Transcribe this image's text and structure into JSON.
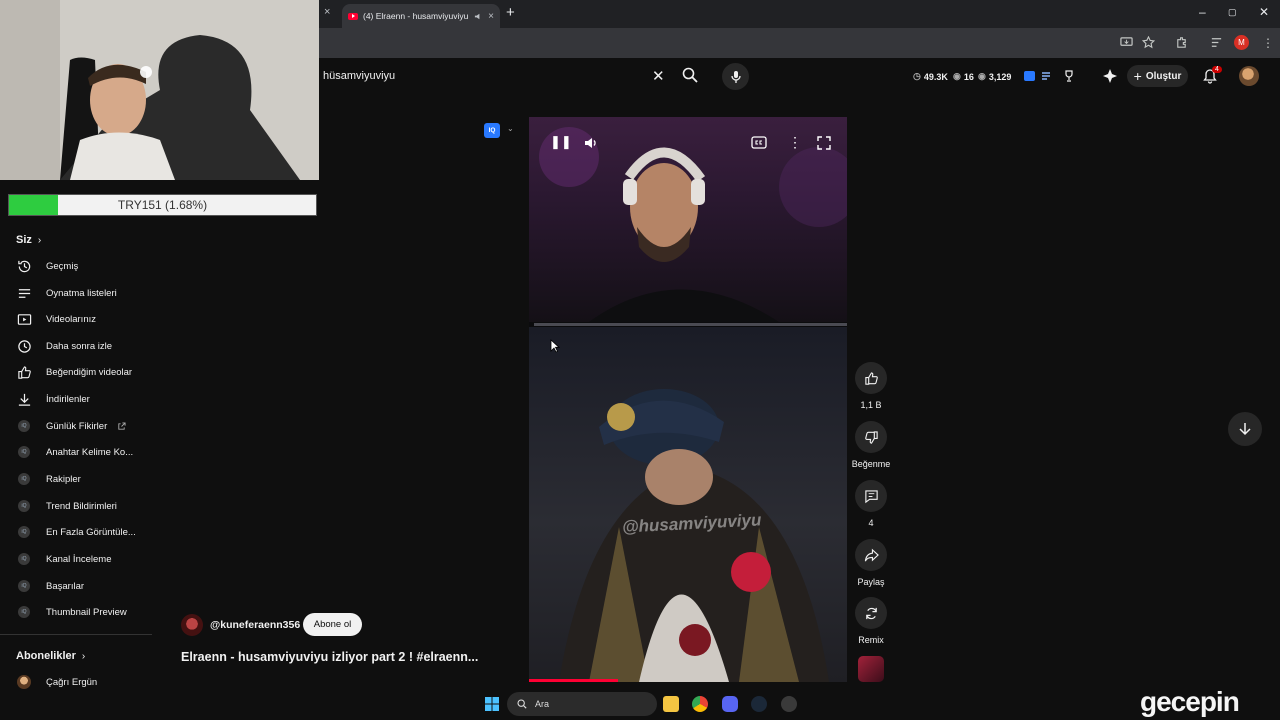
{
  "browser": {
    "tab_title": "(4) Elraenn - husamviyuviyu",
    "tab_close": "×",
    "new_tab": "+",
    "window_controls": [
      "–",
      "▢",
      "✕"
    ],
    "profile_initial": "M"
  },
  "youtube_header": {
    "search_value": "hüsamviyuviyu",
    "stats": {
      "views": "49.3K",
      "count": "16",
      "subs": "3,129"
    },
    "create_label": "Oluştur",
    "notification_count": "4"
  },
  "webcam_overlay": {
    "ticker_label": "TRY151 (1.68%)",
    "ticker_progress": 0.16
  },
  "sidebar": {
    "you_heading": "Siz",
    "items": [
      {
        "label": "Geçmiş",
        "icon": "history-icon"
      },
      {
        "label": "Oynatma listeleri",
        "icon": "playlist-icon"
      },
      {
        "label": "Videolarınız",
        "icon": "your-videos-icon"
      },
      {
        "label": "Daha sonra izle",
        "icon": "watch-later-icon"
      },
      {
        "label": "Beğendiğim videolar",
        "icon": "thumb-up-icon"
      },
      {
        "label": "İndirilenler",
        "icon": "download-icon"
      }
    ],
    "vidiq_items": [
      {
        "label": "Günlük Fikirler"
      },
      {
        "label": "Anahtar Kelime Ko..."
      },
      {
        "label": "Rakipler"
      },
      {
        "label": "Trend Bildirimleri"
      },
      {
        "label": "En Fazla Görüntüle..."
      },
      {
        "label": "Kanal İnceleme"
      },
      {
        "label": "Başarılar"
      },
      {
        "label": "Thumbnail Preview"
      }
    ],
    "subscriptions_heading": "Abonelikler",
    "subscriptions": [
      {
        "label": "Çağrı Ergün"
      }
    ]
  },
  "short": {
    "vidiq_badge": "IQ",
    "watermark": "@husamviyuviyu",
    "channel_handle": "@kuneferaenn356",
    "subscribe_label": "Abone ol",
    "title": "Elraenn - husamviyuviyu izliyor part 2 ! #elraenn...",
    "progress": 0.28,
    "actions": {
      "like_count": "1,1 B",
      "dislike_label": "Beğenme",
      "comment_count": "4",
      "share_label": "Paylaş",
      "remix_label": "Remix"
    }
  },
  "taskbar": {
    "search_placeholder": "Ara"
  },
  "brand_logo": "gecepin"
}
